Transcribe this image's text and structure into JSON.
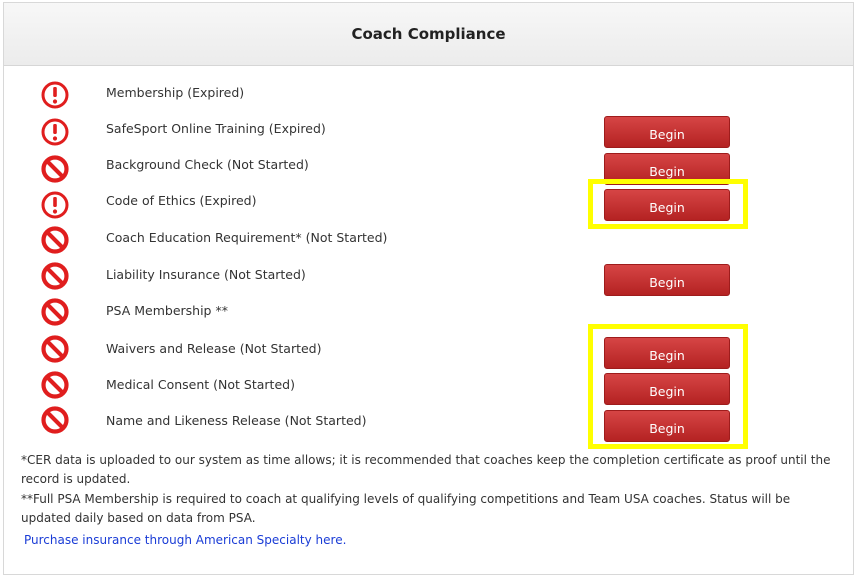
{
  "header": {
    "title": "Coach Compliance"
  },
  "colors": {
    "alert_red": "#e01e1e",
    "button_red": "#c33131",
    "highlight": "#ffff00",
    "link_blue": "#1a3cd6"
  },
  "requirements": [
    {
      "label": "Membership (Expired)",
      "status_icon": "exclamation-circle-icon",
      "button": ""
    },
    {
      "label": "SafeSport Online Training (Expired)",
      "status_icon": "exclamation-circle-icon",
      "button": "Begin"
    },
    {
      "label": "Background Check (Not Started)",
      "status_icon": "prohibited-icon",
      "button": "Begin"
    },
    {
      "label": "Code of Ethics (Expired)",
      "status_icon": "exclamation-circle-icon",
      "button": "Begin"
    },
    {
      "label": "Coach Education Requirement* (Not Started)",
      "status_icon": "prohibited-icon",
      "button": ""
    },
    {
      "label": "Liability Insurance (Not Started)",
      "status_icon": "prohibited-icon",
      "button": "Begin"
    },
    {
      "label": "PSA Membership **",
      "status_icon": "prohibited-icon",
      "button": ""
    },
    {
      "label": "Waivers and Release (Not Started)",
      "status_icon": "prohibited-icon",
      "button": "Begin"
    },
    {
      "label": "Medical Consent (Not Started)",
      "status_icon": "prohibited-icon",
      "button": "Begin"
    },
    {
      "label": "Name and Likeness Release (Not Started)",
      "status_icon": "prohibited-icon",
      "button": "Begin"
    }
  ],
  "notes": {
    "cer": "*CER data is uploaded to our system as time allows; it is recommended that coaches keep the completion certificate as proof until the record is updated.",
    "psa": "**Full PSA Membership is required to coach at qualifying levels of qualifying competitions and Team USA coaches. Status will be updated daily based on data from PSA.",
    "insurance_link": "Purchase insurance through American Specialty here."
  }
}
